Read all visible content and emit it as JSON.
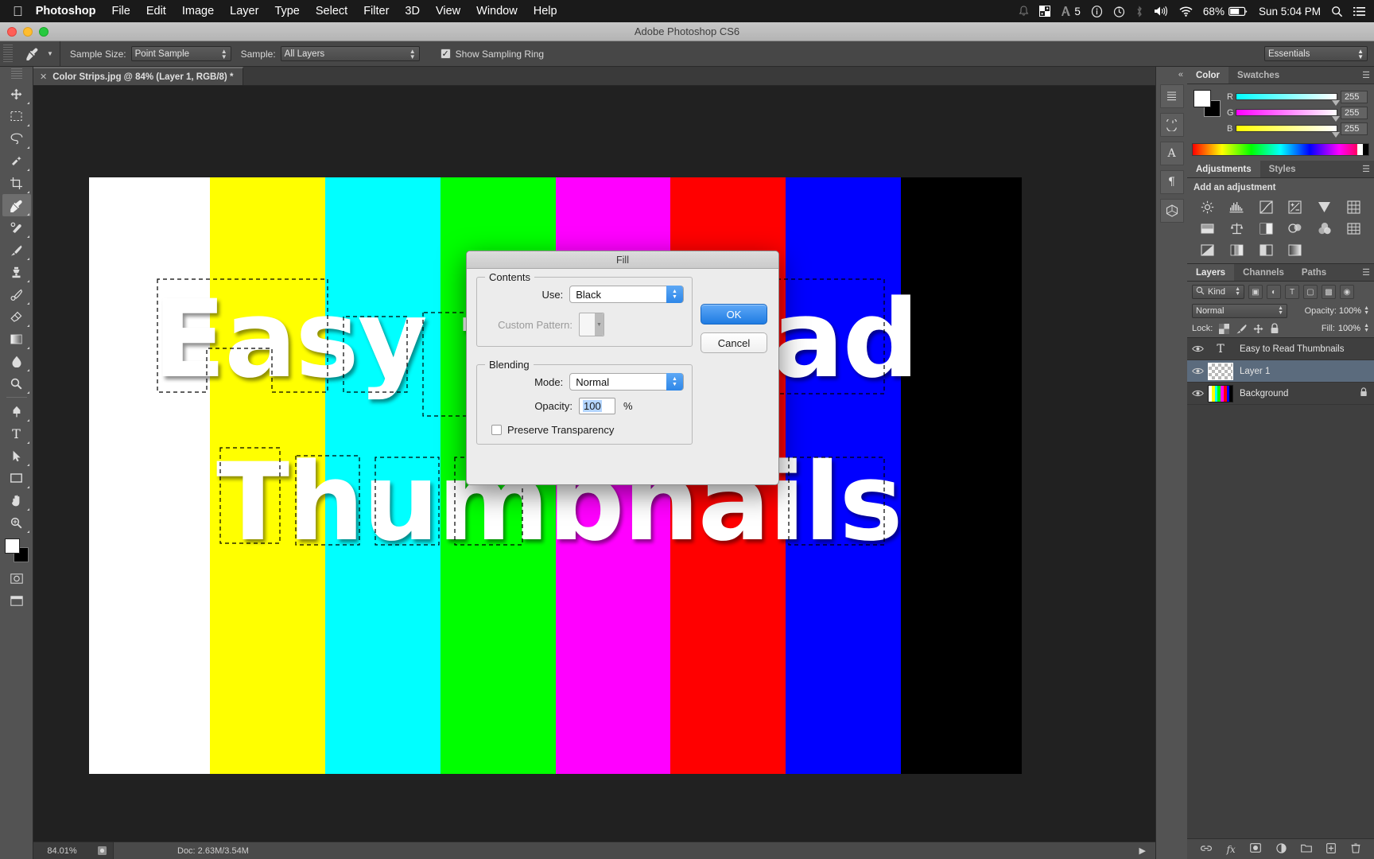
{
  "menubar": {
    "apple_icon": "apple-logo",
    "app_name": "Photoshop",
    "items": [
      "File",
      "Edit",
      "Image",
      "Layer",
      "Type",
      "Select",
      "Filter",
      "3D",
      "View",
      "Window",
      "Help"
    ],
    "status": {
      "notification_icon": "bell-icon",
      "grid_icon": "grid-icon",
      "adobe_icon": "adobe-icon",
      "adobe_count": "5",
      "info_icon": "info-circle-icon",
      "timemachine_icon": "clock-icon",
      "bluetooth_icon": "bluetooth-icon",
      "volume_icon": "speaker-icon",
      "wifi_icon": "wifi-icon",
      "battery_percent": "68%",
      "battery_icon": "battery-icon",
      "clock": "Sun 5:04 PM",
      "search_icon": "search-icon",
      "menu_icon": "list-icon"
    }
  },
  "window": {
    "title": "Adobe Photoshop CS6"
  },
  "options_bar": {
    "tool_icon": "eyedropper-icon",
    "sample_size_label": "Sample Size:",
    "sample_size_value": "Point Sample",
    "sample_label": "Sample:",
    "sample_value": "All Layers",
    "show_sampling_ring_label": "Show Sampling Ring",
    "show_sampling_ring_checked": "✓",
    "workspace": "Essentials"
  },
  "toolbar": {
    "tools": [
      {
        "name": "move-tool",
        "glyph": "✥"
      },
      {
        "name": "marquee-tool",
        "glyph": "⬚"
      },
      {
        "name": "lasso-tool",
        "glyph": "⊂"
      },
      {
        "name": "quick-selection-tool",
        "glyph": "✎"
      },
      {
        "name": "crop-tool",
        "glyph": "⌧"
      },
      {
        "name": "eyedropper-tool",
        "glyph": "☂"
      },
      {
        "name": "spot-healing-tool",
        "glyph": "⚕"
      },
      {
        "name": "brush-tool",
        "glyph": "✐"
      },
      {
        "name": "clone-stamp-tool",
        "glyph": "⚲"
      },
      {
        "name": "history-brush-tool",
        "glyph": "✿"
      },
      {
        "name": "eraser-tool",
        "glyph": "◪"
      },
      {
        "name": "gradient-tool",
        "glyph": "▧"
      },
      {
        "name": "blur-tool",
        "glyph": "●"
      },
      {
        "name": "dodge-tool",
        "glyph": "⚬"
      },
      {
        "name": "pen-tool",
        "glyph": "✒"
      },
      {
        "name": "type-tool",
        "glyph": "T"
      },
      {
        "name": "path-selection-tool",
        "glyph": "▶"
      },
      {
        "name": "rectangle-tool",
        "glyph": "▭"
      },
      {
        "name": "hand-tool",
        "glyph": "✋"
      },
      {
        "name": "zoom-tool",
        "glyph": "⌕"
      }
    ],
    "foreground_color": "#ffffff",
    "background_color": "#000000"
  },
  "document": {
    "tab_close": "✕",
    "tab_title": "Color Strips.jpg @ 84% (Layer 1, RGB/8) *",
    "artwork_line1": "Easy to Read",
    "artwork_line2": "Thumbnails",
    "strips": [
      "#ffffff",
      "#ffff00",
      "#00ffff",
      "#00ff00",
      "#ff00ff",
      "#ff0000",
      "#0000ff",
      "#000000"
    ]
  },
  "statusbar": {
    "zoom": "84.01%",
    "doc_icon": "document-icon",
    "doc_info": "Doc: 2.63M/3.54M",
    "arrow_icon": "play-arrow-icon"
  },
  "fill_dialog": {
    "title": "Fill",
    "contents_legend": "Contents",
    "use_label": "Use:",
    "use_value": "Black",
    "custom_pattern_label": "Custom Pattern:",
    "blending_legend": "Blending",
    "mode_label": "Mode:",
    "mode_value": "Normal",
    "opacity_label": "Opacity:",
    "opacity_value": "100",
    "percent": "%",
    "preserve_transparency_label": "Preserve Transparency",
    "ok_label": "OK",
    "cancel_label": "Cancel"
  },
  "dock": {
    "collapse_icon": "collapse-arrows-icon",
    "buttons": [
      {
        "name": "history-panel-icon",
        "glyph": "↺"
      },
      {
        "name": "properties-panel-icon",
        "glyph": "▤"
      },
      {
        "name": "character-panel-icon",
        "glyph": "A"
      },
      {
        "name": "paragraph-panel-icon",
        "glyph": "¶"
      },
      {
        "name": "3d-panel-icon",
        "glyph": "⬡"
      }
    ]
  },
  "color_panel": {
    "tabs": [
      "Color",
      "Swatches"
    ],
    "active_tab": "Color",
    "menu_icon": "panel-menu-icon",
    "foreground": "#ffffff",
    "background": "#000000",
    "channels": [
      {
        "label": "R",
        "value": "255"
      },
      {
        "label": "G",
        "value": "255"
      },
      {
        "label": "B",
        "value": "255"
      }
    ]
  },
  "adjustments_panel": {
    "tabs": [
      "Adjustments",
      "Styles"
    ],
    "active_tab": "Adjustments",
    "heading": "Add an adjustment",
    "icons": [
      {
        "name": "brightness-contrast-icon",
        "glyph": "☀"
      },
      {
        "name": "levels-icon",
        "glyph": "▒"
      },
      {
        "name": "curves-icon",
        "glyph": "↗"
      },
      {
        "name": "exposure-icon",
        "glyph": "±"
      },
      {
        "name": "vibrance-icon",
        "glyph": "▽"
      },
      {
        "name": "hue-saturation-icon",
        "glyph": "▦"
      },
      {
        "name": "color-balance-icon",
        "glyph": "⚖"
      },
      {
        "name": "black-white-icon",
        "glyph": "◑"
      },
      {
        "name": "photo-filter-icon",
        "glyph": "❂"
      },
      {
        "name": "channel-mixer-icon",
        "glyph": "⬤"
      },
      {
        "name": "color-lookup-icon",
        "glyph": "⊞"
      },
      {
        "name": "invert-icon",
        "glyph": "◧"
      },
      {
        "name": "posterize-icon",
        "glyph": "◫"
      },
      {
        "name": "threshold-icon",
        "glyph": "◨"
      },
      {
        "name": "gradient-map-icon",
        "glyph": "▨"
      },
      {
        "name": "selective-color-icon",
        "glyph": "▣"
      }
    ]
  },
  "layers_panel": {
    "tabs": [
      "Layers",
      "Channels",
      "Paths"
    ],
    "active_tab": "Layers",
    "menu_icon": "panel-menu-icon",
    "filter_label": "Kind",
    "filter_icon": "search-icon",
    "blend_mode": "Normal",
    "opacity_label": "Opacity:",
    "opacity_value": "100%",
    "lock_label": "Lock:",
    "lock_icons": [
      "transparency-lock-icon",
      "paint-lock-icon",
      "position-lock-icon",
      "all-lock-icon"
    ],
    "fill_label": "Fill:",
    "fill_value": "100%",
    "layers": [
      {
        "name": "Easy to Read Thumbnails",
        "type": "text",
        "visible": true,
        "selected": false,
        "locked": false
      },
      {
        "name": "Layer 1",
        "type": "pixel-transparent",
        "visible": true,
        "selected": true,
        "locked": false
      },
      {
        "name": "Background",
        "type": "image",
        "visible": true,
        "selected": false,
        "locked": true
      }
    ],
    "bottom_icons": [
      {
        "name": "link-layers-icon",
        "glyph": "⚭"
      },
      {
        "name": "layer-style-icon",
        "glyph": "fx"
      },
      {
        "name": "layer-mask-icon",
        "glyph": "□"
      },
      {
        "name": "adjustment-layer-icon",
        "glyph": "◐"
      },
      {
        "name": "new-group-icon",
        "glyph": "▢"
      },
      {
        "name": "new-layer-icon",
        "glyph": "⊞"
      },
      {
        "name": "delete-layer-icon",
        "glyph": "Ὕ1"
      }
    ]
  }
}
